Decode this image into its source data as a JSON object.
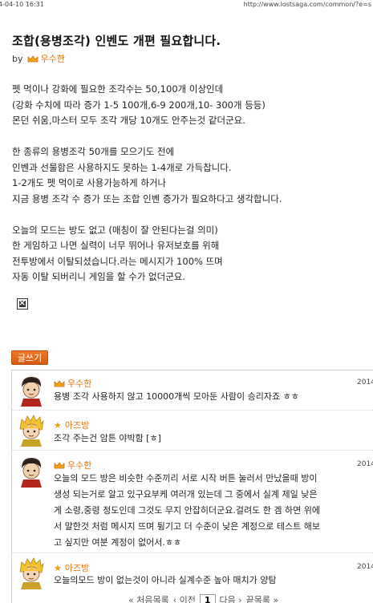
{
  "topbar": {
    "date": "4-04-10 16:31",
    "url": "http://www.lostsaga.com/common/?e=s"
  },
  "article": {
    "title": "조합(용병조각) 인벤도 개편 필요합니다.",
    "by": "by",
    "author": "우수한",
    "paragraphs": [
      [
        "펫 먹이나 강화에 필요한 조각수는 50,100개 이상인데",
        "(강화 수치에 따라 증가 1-5 100개,6-9 200개,10- 300개 등등)",
        "몬던 쉬움,마스터 모두 조각 개당 10개도 안주는것 같더군요."
      ],
      [
        "한 종류의 용병조각 50개를 모으기도 전에",
        "인벤과 선물함은 사용하지도 못하는 1-4개로 가득찹니다.",
        "1-2개도 펫 먹이로 사용가능하게 하거나",
        "지금 용병 조각 수 증가 또는 조합 인벤 증가가 필요하다고 생각합니다."
      ],
      [
        "오늘의 모드는 방도 없고 (매칭이 잘 안된다는걸 의미)",
        "한 게임하고 나면 실력이 너무 뛰어나 유저보호를 위해",
        "전투방에서 이탈되셨습니다.라는 메시지가 100% 뜨며",
        "자동 이탈 되버리니 게임을 할 수가 없더군요."
      ]
    ]
  },
  "write_button": "글쓰기",
  "comments": [
    {
      "name": "우수한",
      "rank": "crown",
      "date": "2014-",
      "lines": [
        "용병 조각 사용하지 않고 10000개씩 모아둔 사람이 승리자죠 ㅎㅎ"
      ]
    },
    {
      "name": "아즈방",
      "rank": "star",
      "date": "2014-",
      "lines": [
        "조각 주는건 암튼 야박함 [ㅎ]"
      ]
    },
    {
      "name": "우수한",
      "rank": "crown",
      "date": "2014-",
      "lines": [
        "오늘의 모드 방은 비슷한 수준끼리 서로 시작 버튼 눌러서 만났을때 방이",
        "생성 되는거로 알고 있구요부케 여러개 있는데 그 중에서 실계 제일 낮은",
        "게 소령,중령 정도인데 그것도 무지 안잡히더군요.걸려도 한 겜 하면 위에",
        "서 말한것 처럼 메시지 뜨며 튕기고 더 수준이 낮은 계정으로 테스트 해보",
        "고 싶지만 여분 계정이 없어서.ㅎㅎ"
      ]
    },
    {
      "name": "아즈방",
      "rank": "star",
      "date": "2014-",
      "lines": [
        "오늘의모드 방이 없는것이 아니라 실계수준 높아 매치가 양탐"
      ]
    }
  ],
  "pager": {
    "first": "« 처음목록",
    "prev": "‹ 이전",
    "current": "1",
    "next": "다음 ›",
    "last": "끝목록 »"
  },
  "colors": {
    "accent": "#e8740e",
    "button": "#e2661a"
  }
}
